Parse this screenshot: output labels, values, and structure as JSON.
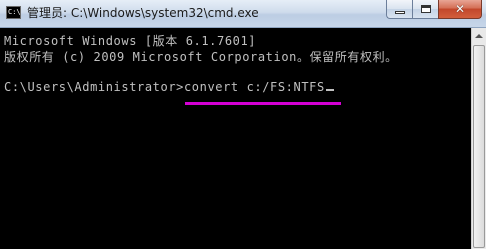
{
  "window": {
    "title": "管理员: C:\\Windows\\system32\\cmd.exe",
    "icon_label": "C:\\",
    "app_icon": "console-icon"
  },
  "caption_buttons": {
    "minimize_icon": "minimize-icon",
    "maximize_icon": "maximize-icon",
    "close_glyph": "✕"
  },
  "console": {
    "lines": [
      "Microsoft Windows [版本 6.1.7601]",
      "版权所有 (c) 2009 Microsoft Corporation。保留所有权利。",
      "",
      "C:\\Users\\Administrator>convert c:/FS:NTFS"
    ],
    "text_color": "#c0c0c0",
    "background_color": "#000000",
    "highlight_color": "#d400d4"
  }
}
